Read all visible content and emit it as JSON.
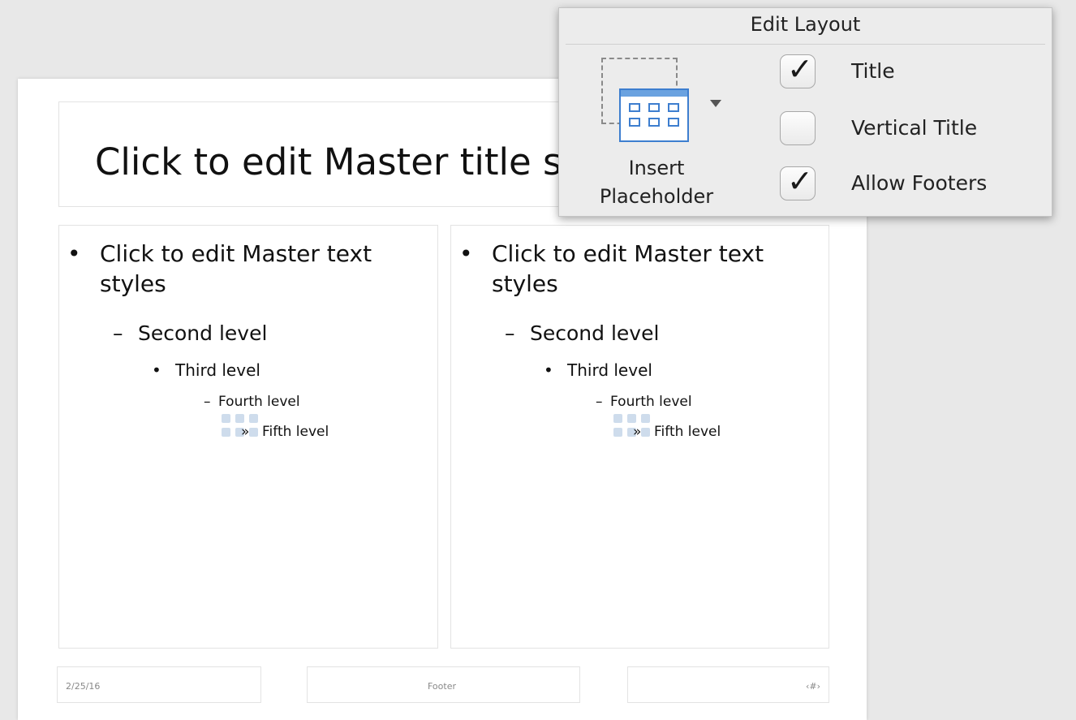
{
  "slide": {
    "title": "Click to edit Master title style",
    "columns": [
      {
        "level1": "Click to edit Master text",
        "level1_cont": "styles",
        "level2": "Second level",
        "level3": "Third level",
        "level4": "Fourth level",
        "level5": "Fifth level"
      },
      {
        "level1": "Click to edit Master text",
        "level1_cont": "styles",
        "level2": "Second level",
        "level3": "Third level",
        "level4": "Fourth level",
        "level5": "Fifth level"
      }
    ],
    "bullets": {
      "l1": "•",
      "l2": "–",
      "l3": "•",
      "l4": "–",
      "l5": "»"
    },
    "footer": {
      "date": "2/25/16",
      "center": "Footer",
      "slide_number": "‹#›"
    }
  },
  "edit_layout": {
    "group_title": "Edit Layout",
    "insert_placeholder": {
      "label_line1": "Insert",
      "label_line2": "Placeholder",
      "icon": "insert-placeholder-icon"
    },
    "options": [
      {
        "label": "Title",
        "checked": true
      },
      {
        "label": "Vertical Title",
        "checked": false
      },
      {
        "label": "Allow Footers",
        "checked": true
      }
    ],
    "check_glyph": "✓"
  }
}
